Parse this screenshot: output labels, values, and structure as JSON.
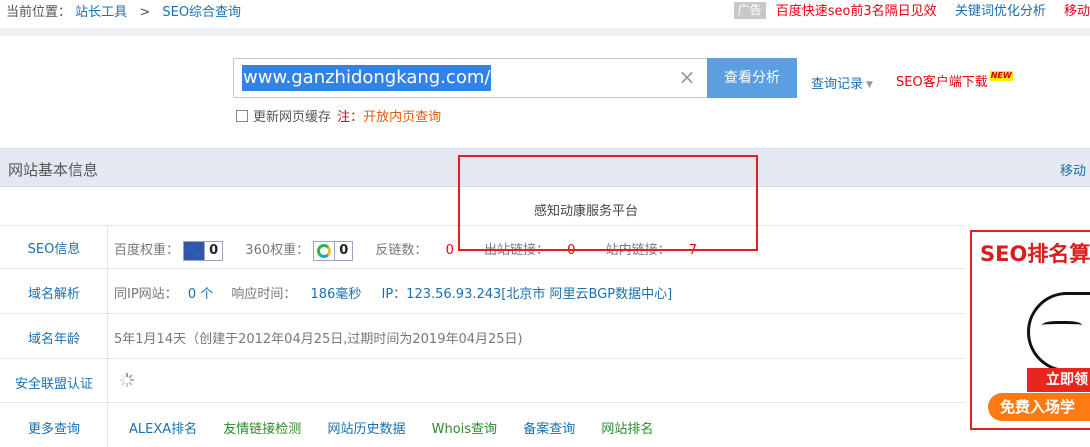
{
  "breadcrumb": {
    "prefix": "当前位置：",
    "items": [
      "站长工具",
      "SEO综合查询"
    ],
    "separator": ">"
  },
  "top_right": {
    "ad_badge": "广告",
    "promo": "百度快速seo前3名隔日见效",
    "keyword_link": "关键词优化分析",
    "move_link": "移动"
  },
  "search": {
    "value": "www.ganzhidongkang.com/",
    "button": "查看分析",
    "history": "查询记录",
    "client_download": "SEO客户端下载",
    "new_badge": "NEW",
    "cache_checkbox_label": "更新网页缓存",
    "note_prefix": "注：",
    "note_link": "开放内页查询"
  },
  "section": {
    "title": "网站基本信息",
    "right_link": "移动"
  },
  "site_title": "感知动康服务平台",
  "rows": {
    "seo": {
      "label": "SEO信息",
      "baidu_label": "百度权重：",
      "baidu_value": "0",
      "s360_label": "360权重：",
      "s360_value": "0",
      "backlink_label": "反链数：",
      "backlink_value": "0",
      "outlink_label": "出站链接：",
      "outlink_value": "0",
      "inlink_label": "站内链接：",
      "inlink_value": "7"
    },
    "dns": {
      "label": "域名解析",
      "sameip_label": "同IP网站：",
      "sameip_value": "0 个",
      "resp_label": "响应时间：",
      "resp_value": "186毫秒",
      "ip_text": "IP：123.56.93.243[北京市 阿里云BGP数据中心]"
    },
    "age": {
      "label": "域名年龄",
      "value": "5年1月14天（创建于2012年04月25日,过期时间为2019年04月25日)"
    },
    "safety": {
      "label": "安全联盟认证"
    },
    "more": {
      "label": "更多查询",
      "links": [
        "ALEXA排名",
        "友情链接检测",
        "网站历史数据",
        "Whois查询",
        "备案查询",
        "网站排名"
      ]
    }
  },
  "side_ad": {
    "title": "SEO排名算",
    "cta1": "立即领",
    "cta2": "免费入场学"
  },
  "colors": {
    "link_blue": "#1a6fb0",
    "accent_red": "#e60012",
    "button_blue": "#5b9fe0",
    "header_bg": "#e4e8f0"
  }
}
